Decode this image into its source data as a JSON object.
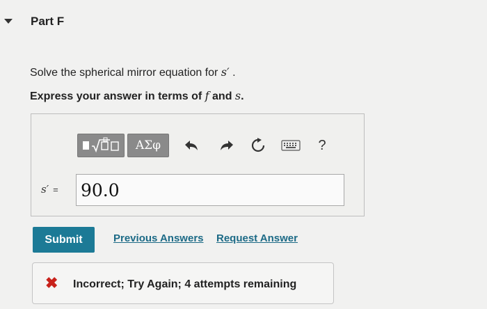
{
  "part": {
    "title": "Part F"
  },
  "question": {
    "text_before": "Solve the spherical mirror equation for ",
    "symbol": "s′",
    "text_after": " ."
  },
  "instruction": {
    "text_before": "Express your answer in terms of ",
    "var1": "f",
    "text_mid": " and ",
    "var2": "s",
    "text_after": "."
  },
  "toolbar": {
    "greek_label": "ΑΣφ",
    "help_label": "?",
    "icons": [
      "templates-icon",
      "undo-icon",
      "redo-icon",
      "reset-icon",
      "keyboard-icon"
    ]
  },
  "answer": {
    "variable": "s′",
    "equals": "=",
    "value": "90.0"
  },
  "actions": {
    "submit_label": "Submit",
    "previous_answers_label": "Previous Answers",
    "request_answer_label": "Request Answer"
  },
  "feedback": {
    "icon": "x-icon",
    "text": "Incorrect; Try Again; 4 attempts remaining",
    "color": "#c8221b"
  }
}
